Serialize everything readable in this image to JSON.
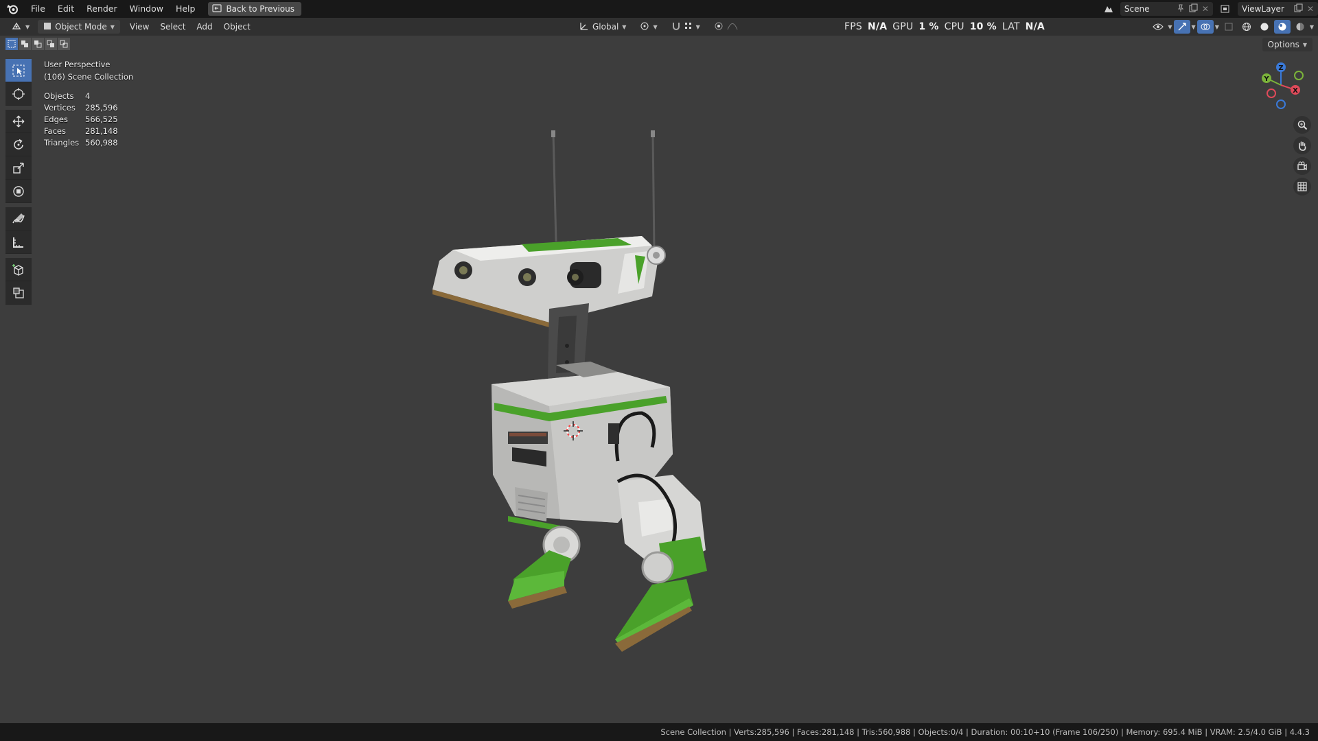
{
  "topbar": {
    "menu": [
      "File",
      "Edit",
      "Render",
      "Window",
      "Help"
    ],
    "back_button": "Back to Previous",
    "scene_name": "Scene",
    "view_layer_name": "ViewLayer"
  },
  "header": {
    "mode": "Object Mode",
    "menus": [
      "View",
      "Select",
      "Add",
      "Object"
    ],
    "transform_orientation": "Global",
    "stats": {
      "fps_label": "FPS",
      "fps_value": "N/A",
      "gpu_label": "GPU",
      "gpu_value": "1 %",
      "cpu_label": "CPU",
      "cpu_value": "10 %",
      "lat_label": "LAT",
      "lat_value": "N/A"
    },
    "viewport_shading": "material-preview"
  },
  "viewport": {
    "options_label": "Options",
    "perspective": "User Perspective",
    "collection": "(106) Scene Collection",
    "stats": [
      {
        "label": "Objects",
        "value": "4"
      },
      {
        "label": "Vertices",
        "value": "285,596"
      },
      {
        "label": "Edges",
        "value": "566,525"
      },
      {
        "label": "Faces",
        "value": "281,148"
      },
      {
        "label": "Triangles",
        "value": "560,988"
      }
    ],
    "gizmo_axes": {
      "x": "X",
      "y": "Y",
      "z": "Z"
    },
    "axis_colors": {
      "x": "#e04a5a",
      "y": "#7bb33a",
      "z": "#3a7ad9"
    }
  },
  "statusbar": {
    "text": "Scene Collection | Verts:285,596 | Faces:281,148 | Tris:560,988 | Objects:0/4 | Duration: 00:10+10 (Frame 106/250) | Memory: 695.4 MiB | VRAM: 2.5/4.0 GiB | 4.4.3"
  },
  "colors": {
    "accent": "#4772b3",
    "viewport_bg": "#3d3d3d",
    "robot_green": "#4aa12a"
  },
  "icons": {
    "logo": "blender-logo-icon",
    "tools": [
      "select-box-icon",
      "cursor-icon",
      "move-icon",
      "rotate-icon",
      "scale-icon",
      "transform-icon",
      "annotate-icon",
      "measure-icon",
      "add-cube-icon",
      "add-object-icon"
    ],
    "nav": [
      "zoom-icon",
      "pan-hand-icon",
      "camera-icon",
      "grid-view-icon"
    ]
  }
}
